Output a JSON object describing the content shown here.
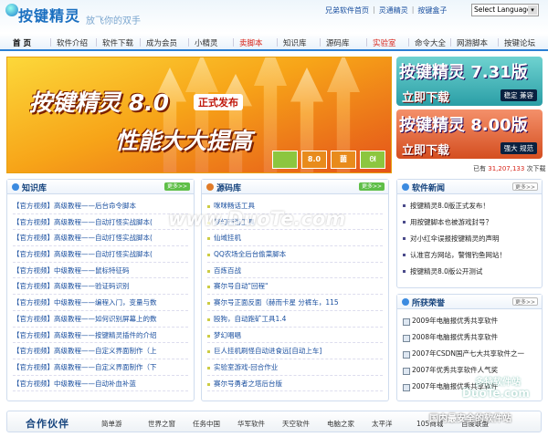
{
  "header": {
    "logo": "按键精灵",
    "slogan": "放飞你的双手",
    "links": [
      "兄弟软件首页",
      "灵通精灵",
      "按键盒子"
    ],
    "language": "Select Language"
  },
  "nav": [
    {
      "label": "首 页",
      "active": true
    },
    {
      "label": "软件介绍"
    },
    {
      "label": "软件下载"
    },
    {
      "label": "成为会员"
    },
    {
      "label": "小精灵"
    },
    {
      "label": "卖脚本",
      "color": "#d8261b"
    },
    {
      "label": "知识库"
    },
    {
      "label": "源码库"
    },
    {
      "label": "实验室",
      "color": "#d8261b"
    },
    {
      "label": "命令大全"
    },
    {
      "label": "网游脚本"
    },
    {
      "label": "按键论坛"
    }
  ],
  "banner": {
    "line1": "按键精灵 8.0",
    "badge": "正式发布",
    "line2": "性能大大提高",
    "thumbs": [
      "",
      "8.0",
      "菌",
      "ᘛ"
    ]
  },
  "downloads": [
    {
      "name": "按键精灵 7.31版",
      "action": "立即下载",
      "tag": "稳定 兼容"
    },
    {
      "name": "按键精灵 8.00版",
      "action": "立即下载",
      "tag": "强大 规范"
    }
  ],
  "counter": {
    "prefix": "已有",
    "value": "31,207,133",
    "suffix": "次下载"
  },
  "knowledge": {
    "title": "知识库",
    "more": "更多>>",
    "items": [
      "【官方视频】高级教程——后台命令脚本",
      "【官方视频】高级教程——自动打怪实战脚本(",
      "【官方视频】高级教程——自动打怪实战脚本(",
      "【官方视频】高级教程——自动打怪实战脚本(",
      "【官方视频】中级教程——鼠标特征码",
      "【官方视频】高级教程——验证码识别",
      "【官方视频】中级教程——编程入门，变量与数",
      "【官方视频】高级教程——如何识别屏幕上的数",
      "【官方视频】高级教程——按键精灵插件的介绍",
      "【官方视频】高级教程——自定义界面制作（上",
      "【官方视频】高级教程——自定义界面制作（下",
      "【官方视频】中级教程——自动补血补蓝"
    ]
  },
  "source": {
    "title": "源码库",
    "more": "更多>>",
    "items": [
      "咪咪畅话工具",
      "梦幻西游工具",
      "仙域挂机",
      "QQ农场全后台偷菜脚本",
      "百炼百战",
      "赛尔号自动\"回程\"",
      "赛尔号正面反面（赫而卡星 分裤车，115",
      "殴狗，自动跑矿工具1.4",
      "梦幻唱唱",
      "巨人挂机刷怪自动进食远[自动上车]",
      "实验室游戏-回合作业",
      "赛尔号勇者之塔后台版"
    ]
  },
  "news": {
    "title": "软件新闻",
    "more": "更多>>",
    "items": [
      "按键精灵8.0版正式发布！",
      "用按键脚本也被游戏封号？",
      "对小红伞误报按键精灵的声明",
      "认准官方网站，警惕钓鱼网站！",
      "按键精灵8.0版公开测试"
    ]
  },
  "honor": {
    "title": "所获荣誉",
    "more": "更多>>",
    "items": [
      "2009年电脑报优秀共享软件",
      "2008年电脑报优秀共享软件",
      "2007年CSDN国产七大共享软件之一",
      "2007年优秀共享软件人气奖",
      "2007年电脑报优秀共享软件"
    ]
  },
  "partners": {
    "label": "合作伙伴",
    "links": [
      "简单游",
      "世界之窗",
      "任务中国",
      "华军软件",
      "天空软件",
      "电脑之家",
      "太平洋",
      "105商城",
      "百度联盟"
    ]
  },
  "watermarks": [
    "www.DuoTe.com",
    "DuoTe.com",
    "多特软件站",
    "国内最安全的软件站"
  ],
  "colors": {
    "accent": "#2b7fd4",
    "red": "#d8261b"
  }
}
